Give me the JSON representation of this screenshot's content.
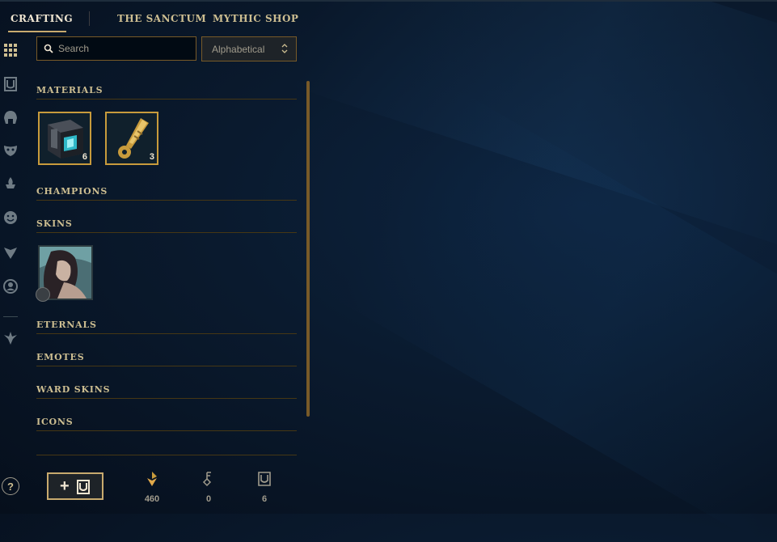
{
  "nav": {
    "tabs": [
      {
        "label": "CRAFTING",
        "active": true
      },
      {
        "label": "THE SANCTUM",
        "active": false
      },
      {
        "label": "MYTHIC SHOP",
        "active": false
      }
    ]
  },
  "rail": {
    "icons": [
      "grid-icon",
      "chest-icon",
      "helmet-icon",
      "mask-icon",
      "ward-icon",
      "emote-icon",
      "eternal-icon",
      "profile-icon",
      "companion-icon"
    ],
    "help_label": "?"
  },
  "search": {
    "placeholder": "Search",
    "value": ""
  },
  "sort": {
    "selected": "Alphabetical"
  },
  "sections": {
    "materials": "MATERIALS",
    "champions": "CHAMPIONS",
    "skins": "SKINS",
    "eternals": "ETERNALS",
    "emotes": "EMOTES",
    "ward_skins": "WARD SKINS",
    "icons": "ICONS"
  },
  "materials": [
    {
      "name": "Hextech Chest",
      "count": "6"
    },
    {
      "name": "Hextech Key",
      "count": "3"
    }
  ],
  "footer": {
    "add_label": "+",
    "currencies": [
      {
        "icon": "orange-essence-icon",
        "value": "460"
      },
      {
        "icon": "key-fragment-icon",
        "value": "0"
      },
      {
        "icon": "chest-count-icon",
        "value": "6"
      }
    ]
  },
  "colors": {
    "gold": "#c8aa6e",
    "gold_dark": "#785a28",
    "text": "#cdbe91",
    "bg": "#0a1a2e"
  }
}
